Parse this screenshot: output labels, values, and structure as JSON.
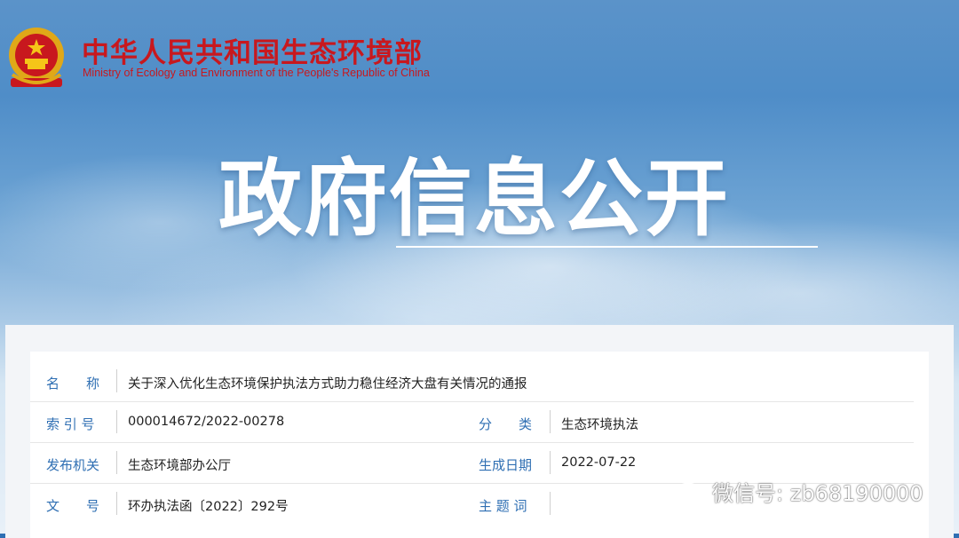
{
  "header": {
    "org_name_cn": "中华人民共和国生态环境部",
    "org_name_en": "Ministry of Ecology and Environment of the People's Republic of China",
    "emblem_icon": "national-emblem-icon"
  },
  "banner": {
    "title": "政府信息公开"
  },
  "info": {
    "name_label": "名　　称",
    "name_value": "关于深入优化生态环境保护执法方式助力稳住经济大盘有关情况的通报",
    "index_label": "索 引 号",
    "index_value": "000014672/2022-00278",
    "category_label": "分　　类",
    "category_value": "生态环境执法",
    "issuer_label": "发布机关",
    "issuer_value": "生态环境部办公厅",
    "date_label": "生成日期",
    "date_value": "2022-07-22",
    "doc_no_label": "文　　号",
    "doc_no_value": "环办执法函〔2022〕292号",
    "keywords_label": "主 题 词",
    "keywords_value": ""
  },
  "watermark": {
    "text": "微信号: zb68190000",
    "icon": "wechat-icon"
  },
  "colors": {
    "brand_red": "#c8181e",
    "label_blue": "#2f6fb3"
  }
}
